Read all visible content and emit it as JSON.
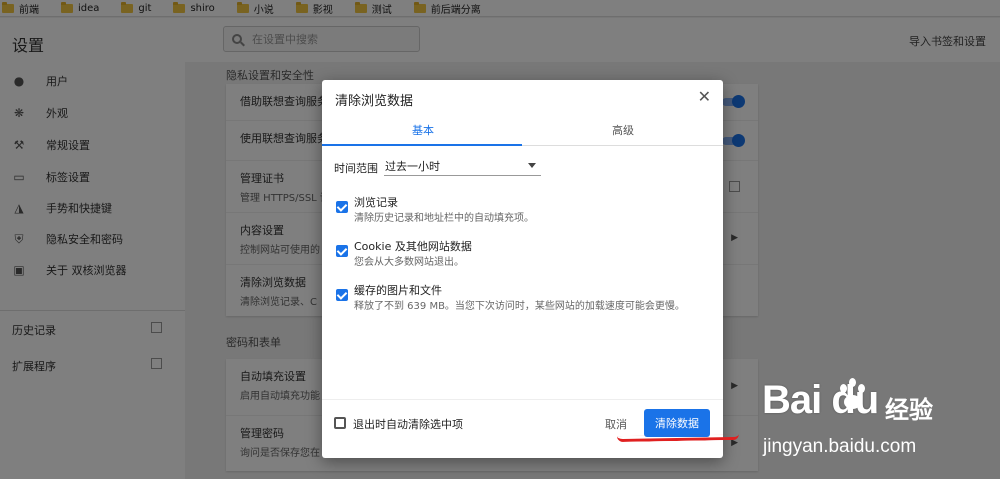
{
  "bookmarks": [
    "前端",
    "idea",
    "git",
    "shiro",
    "小说",
    "影视",
    "测试",
    "前后端分离"
  ],
  "header": {
    "title": "设置",
    "search_placeholder": "在设置中搜索",
    "import_label": "导入书签和设置"
  },
  "sidebar": {
    "items": [
      {
        "label": "用户",
        "icon": "person-icon"
      },
      {
        "label": "外观",
        "icon": "palette-icon"
      },
      {
        "label": "常规设置",
        "icon": "wrench-icon"
      },
      {
        "label": "标签设置",
        "icon": "tab-icon"
      },
      {
        "label": "手势和快捷键",
        "icon": "mouse-icon"
      },
      {
        "label": "隐私安全和密码",
        "icon": "shield-icon"
      },
      {
        "label": "关于 双核浏览器",
        "icon": "clipboard-icon"
      }
    ],
    "links": [
      {
        "label": "历史记录"
      },
      {
        "label": "扩展程序"
      }
    ]
  },
  "content": {
    "privacy_section": "隐私设置和安全性",
    "privacy_rows": [
      {
        "title": "借助联想查询服务",
        "sub": ""
      },
      {
        "title": "使用联想查询服务",
        "sub": ""
      },
      {
        "title": "管理证书",
        "sub": "管理 HTTPS/SSL 证"
      },
      {
        "title": "内容设置",
        "sub": "控制网站可使用的"
      },
      {
        "title": "清除浏览数据",
        "sub": "清除浏览记录、C"
      }
    ],
    "password_section": "密码和表单",
    "password_rows": [
      {
        "title": "自动填充设置",
        "sub": "启用自动填充功能"
      },
      {
        "title": "管理密码",
        "sub": "询问是否保存您在"
      }
    ]
  },
  "dialog": {
    "title": "清除浏览数据",
    "tabs": [
      "基本",
      "高级"
    ],
    "time_range_label": "时间范围",
    "time_range_value": "过去一小时",
    "options": [
      {
        "title": "浏览记录",
        "sub": "清除历史记录和地址栏中的自动填充项。",
        "checked": true
      },
      {
        "title": "Cookie 及其他网站数据",
        "sub": "您会从大多数网站退出。",
        "checked": true
      },
      {
        "title": "缓存的图片和文件",
        "sub": "释放了不到 639 MB。当您下次访问时，某些网站的加载速度可能会更慢。",
        "checked": true
      }
    ],
    "auto_clear_label": "退出时自动清除选中项",
    "cancel_label": "取消",
    "clear_label": "清除数据"
  },
  "watermark": {
    "logo": "Bai du",
    "jing": "经验",
    "url": "jingyan.baidu.com"
  },
  "colors": {
    "accent": "#1a73e8",
    "annotation": "#e02020"
  }
}
